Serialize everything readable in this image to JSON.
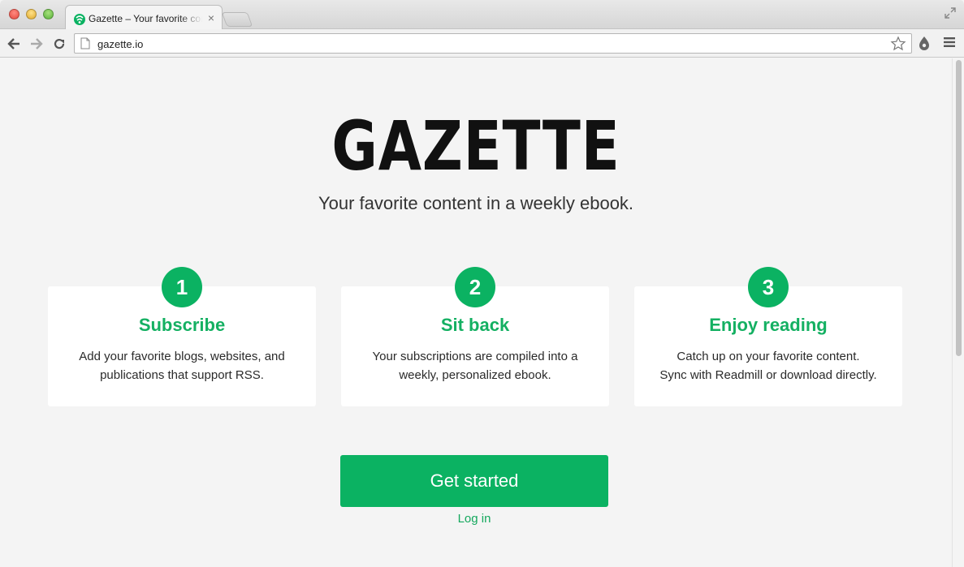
{
  "browser": {
    "tab_title": "Gazette – Your favorite content in a weekly ebook",
    "tab_close": "×",
    "url": "gazette.io"
  },
  "page": {
    "logo": "GAZETTE",
    "tagline": "Your favorite content in a weekly ebook.",
    "steps": [
      {
        "number": "1",
        "title": "Subscribe",
        "line1": "Add your favorite blogs, websites, and",
        "line2": "publications that support RSS."
      },
      {
        "number": "2",
        "title": "Sit back",
        "line1": "Your subscriptions are compiled into a",
        "line2": "weekly, personalized ebook."
      },
      {
        "number": "3",
        "title": "Enjoy reading",
        "line1": "Catch up on your favorite content.",
        "line2": "Sync with Readmill or download directly."
      }
    ],
    "cta_label": "Get started",
    "login_label": "Log in"
  },
  "colors": {
    "accent": "#0bb262",
    "accent_text": "#14b062",
    "background": "#f4f4f4",
    "card": "#ffffff"
  },
  "icons": [
    "close-window-icon",
    "minimize-window-icon",
    "zoom-window-icon",
    "gazette-favicon-icon",
    "tab-close-icon",
    "new-tab-icon",
    "fullscreen-icon",
    "back-arrow-icon",
    "forward-arrow-icon",
    "reload-icon",
    "page-icon",
    "bookmark-star-icon",
    "extension-icon",
    "menu-icon"
  ]
}
